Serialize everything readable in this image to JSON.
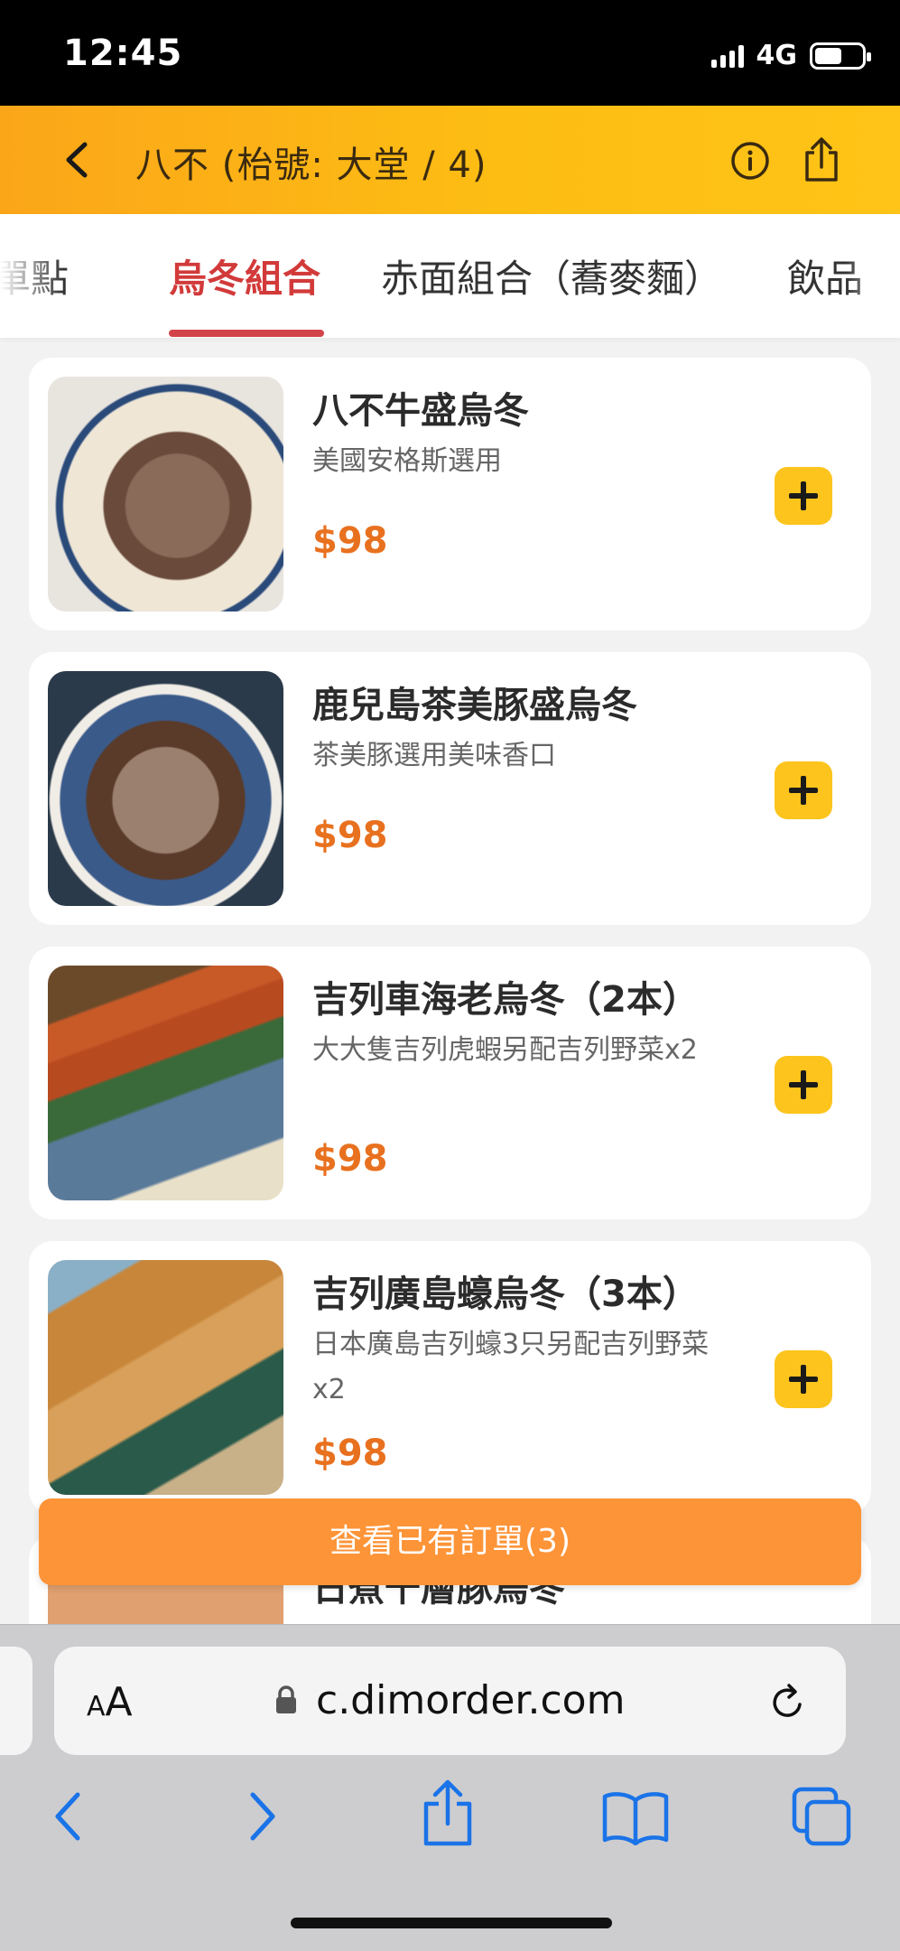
{
  "status": {
    "time": "12:45",
    "network": "4G"
  },
  "header": {
    "title": "八不 (枱號: 大堂 / 4)",
    "icons": [
      "chevron-left-icon",
      "info-icon",
      "share-icon"
    ]
  },
  "tabs": [
    {
      "label": "單點",
      "visible_fragment": "單點"
    },
    {
      "label": "烏冬組合",
      "active": true
    },
    {
      "label": "赤面組合（蕎麥麵）"
    },
    {
      "label": "飲品",
      "visible_fragment": "飲品"
    }
  ],
  "menu": {
    "items": [
      {
        "name": "八不牛盛烏冬",
        "desc": "美國安格斯選用",
        "price": "$98",
        "image": "beef-udon-photo"
      },
      {
        "name": "鹿兒島茶美豚盛烏冬",
        "desc": "茶美豚選用美味香口",
        "price": "$98",
        "image": "pork-udon-photo"
      },
      {
        "name": "吉列車海老烏冬（2本）",
        "desc": "大大隻吉列虎蝦另配吉列野菜x2",
        "price": "$98",
        "image": "fried-prawn-photo"
      },
      {
        "name": "吉列廣島蠔烏冬（3本）",
        "desc": "日本廣島吉列蠔3只另配吉列野菜x2",
        "price": "$98",
        "image": "fried-oyster-photo"
      },
      {
        "name": "日煮千層豚烏冬",
        "partially_hidden": true,
        "image": "layered-pork-photo"
      }
    ]
  },
  "orders_button": {
    "label": "查看已有訂單(3)"
  },
  "safari": {
    "aa_label_small": "A",
    "aa_label_big": "A",
    "url": "c.dimorder.com"
  },
  "colors": {
    "header_gradient_start": "#fba619",
    "header_gradient_end": "#ffc417",
    "active_tab": "#d23a3a",
    "price": "#e8711f",
    "add_button": "#fcc41c",
    "orders_bar": "#fd9438",
    "safari_accent": "#1a73e8"
  }
}
